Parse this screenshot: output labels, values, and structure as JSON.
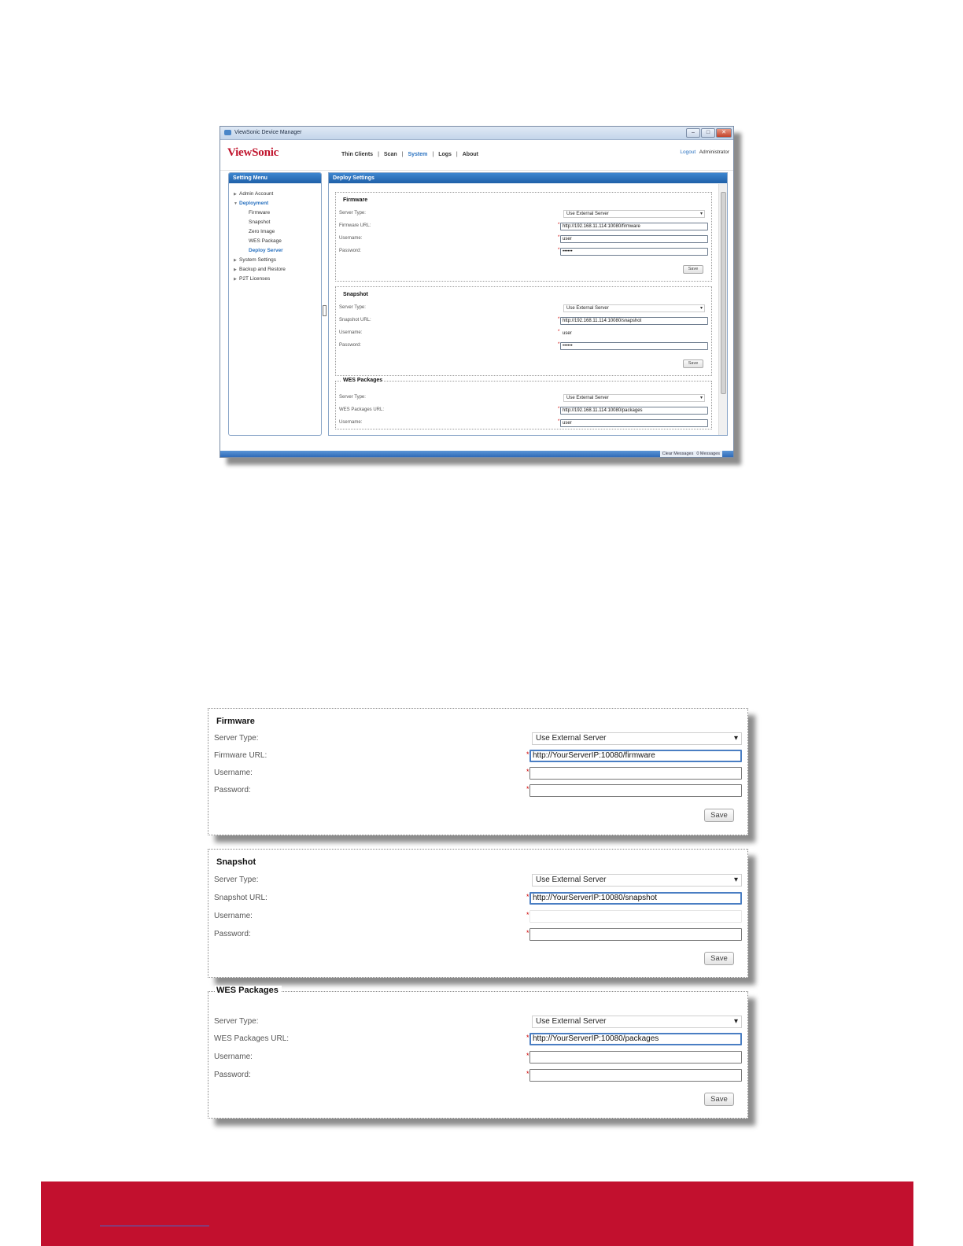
{
  "window": {
    "title": "ViewSonic Device Manager",
    "controls": [
      "–",
      "□",
      "✕"
    ],
    "logo": "ViewSonic",
    "nav": [
      "Thin Clients",
      "Scan",
      "System",
      "Logs",
      "About"
    ],
    "nav_active": "System",
    "logout_label": "Logout",
    "user": "Administrator",
    "sidebar": {
      "title": "Setting Menu",
      "items": [
        {
          "label": "Admin Account",
          "children": []
        },
        {
          "label": "Deployment",
          "children": [
            "Firmware",
            "Snapshot",
            "Zero Image",
            "WES Package",
            "Deploy Server"
          ]
        },
        {
          "label": "System Settings",
          "children": []
        },
        {
          "label": "Backup and Restore",
          "children": []
        },
        {
          "label": "P2T Licenses",
          "children": []
        }
      ],
      "selected_child": "Deploy Server"
    },
    "content_title": "Deploy Settings",
    "sections": [
      {
        "title": "Firmware",
        "server_type_label": "Server Type:",
        "server_type_value": "Use External Server",
        "url_label": "Firmware URL:",
        "url_value": "http://192.168.11.114:10080/firmware",
        "username_label": "Username:",
        "username_value": "user",
        "password_label": "Password:",
        "password_value": "••••••",
        "save_label": "Save"
      },
      {
        "title": "Snapshot",
        "server_type_label": "Server Type:",
        "server_type_value": "Use External Server",
        "url_label": "Snapshot URL:",
        "url_value": "http://192.168.11.114:10080/snapshot",
        "username_label": "Username:",
        "username_value": "user",
        "password_label": "Password:",
        "password_value": "••••••",
        "save_label": "Save"
      },
      {
        "title": "WES Packages",
        "server_type_label": "Server Type:",
        "server_type_value": "Use External Server",
        "url_label": "WES Packages URL:",
        "url_value": "http://192.168.11.114:10080/packages",
        "username_label": "Username:",
        "username_value": "user"
      }
    ],
    "status": {
      "clear_messages": "Clear Messages",
      "messages": "0 Messages"
    }
  },
  "panels": [
    {
      "title": "Firmware",
      "server_type_label": "Server Type:",
      "server_type_value": "Use External Server",
      "url_label": "Firmware URL:",
      "url_value": "http://YourServerIP:10080/firmware",
      "username_label": "Username:",
      "username_value": "",
      "password_label": "Password:",
      "password_value": "",
      "save_label": "Save"
    },
    {
      "title": "Snapshot",
      "server_type_label": "Server Type:",
      "server_type_value": "Use External Server",
      "url_label": "Snapshot URL:",
      "url_value": "http://YourServerIP:10080/snapshot",
      "username_label": "Username:",
      "username_value": "",
      "password_label": "Password:",
      "password_value": "",
      "save_label": "Save"
    },
    {
      "title": "WES Packages",
      "server_type_label": "Server Type:",
      "server_type_value": "Use External Server",
      "url_label": "WES Packages URL:",
      "url_value": "http://YourServerIP:10080/packages",
      "username_label": "Username:",
      "username_value": "",
      "password_label": "Password:",
      "password_value": "",
      "save_label": "Save"
    }
  ],
  "colors": {
    "brand_red": "#c2102e",
    "accent_blue": "#2a72c0",
    "required_red": "#cc0000"
  },
  "icons": [
    "app-icon",
    "minimize-icon",
    "maximize-icon",
    "close-icon",
    "chevron-right-icon",
    "chevron-down-icon",
    "dropdown-arrow-icon"
  ]
}
